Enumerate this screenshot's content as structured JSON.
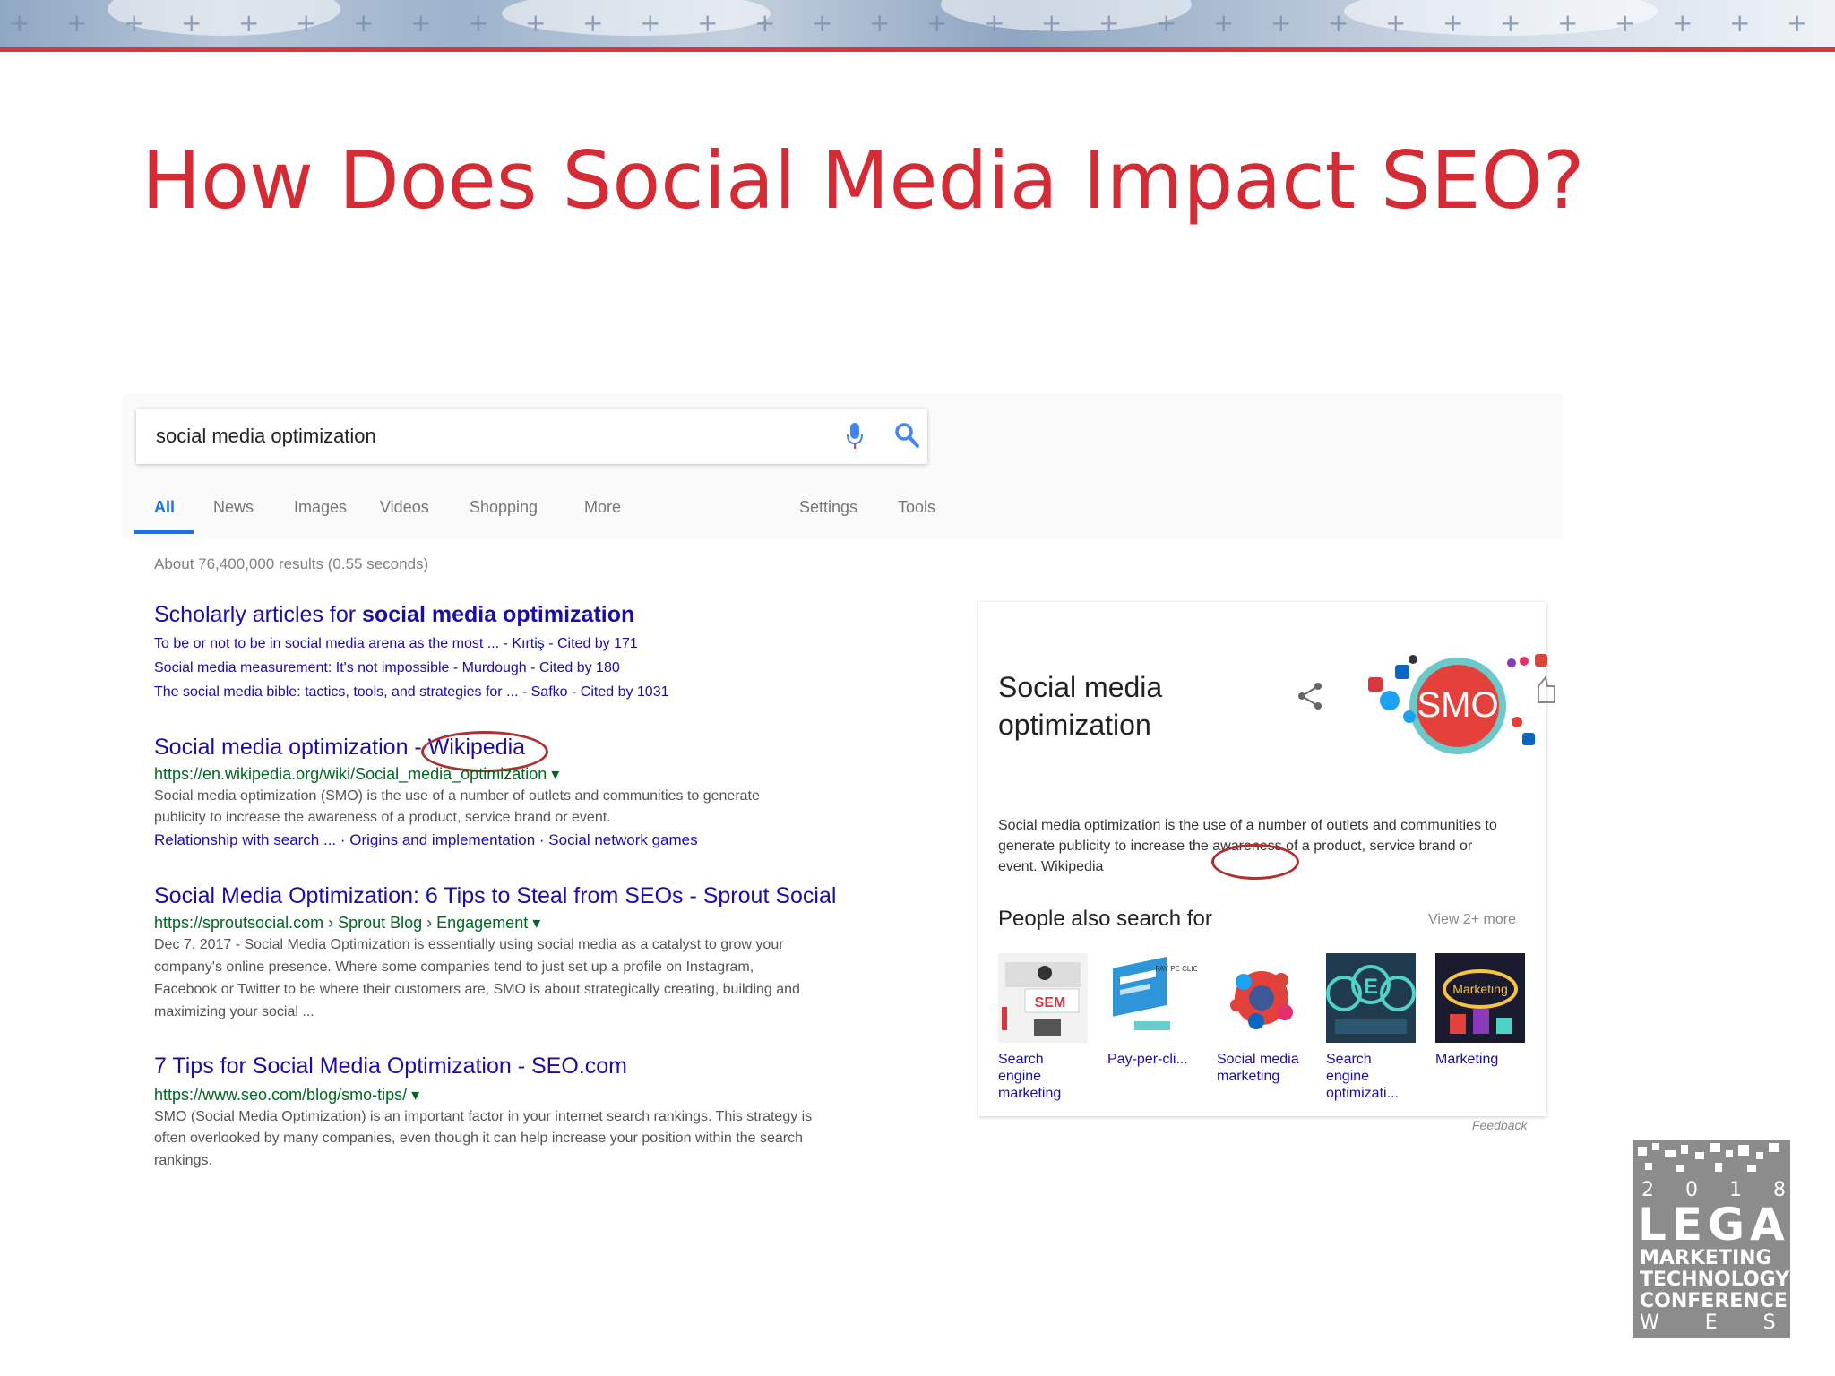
{
  "slide": {
    "title": "How Does Social Media Impact SEO?"
  },
  "search": {
    "query": "social media optimization",
    "tabs": [
      "All",
      "News",
      "Images",
      "Videos",
      "Shopping",
      "More"
    ],
    "settings_label": "Settings",
    "tools_label": "Tools",
    "stats": "About 76,400,000 results (0.55 seconds)"
  },
  "results": {
    "scholar": {
      "title_prefix": "Scholarly articles for ",
      "title_bold": "social media optimization",
      "lines": [
        "To be or not to be in social media arena as the most ... - Kırtiş - Cited by 171",
        "Social media measurement: It's not impossible - Murdough - Cited by 180",
        "The social media bible: tactics, tools, and strategies for ... - Safko - Cited by 1031"
      ]
    },
    "wiki": {
      "title": "Social media optimization - Wikipedia",
      "url": "https://en.wikipedia.org/wiki/Social_media_optimization ▾",
      "snippet": [
        "Social media optimization (SMO) is the use of a number of outlets and communities to generate",
        "publicity to increase the awareness of a product, service brand or event."
      ],
      "sitelinks": "Relationship with search ... · Origins and implementation · Social network games"
    },
    "sprout": {
      "title": "Social Media Optimization: 6 Tips to Steal from SEOs - Sprout Social",
      "url": "https://sproutsocial.com › Sprout Blog › Engagement ▾",
      "snippet": [
        "Dec 7, 2017 - Social Media Optimization is essentially using social media as a catalyst to grow your",
        "company's online presence. Where some companies tend to just set up a profile on Instagram,",
        "Facebook or Twitter to be where their customers are, SMO is about strategically creating, building and",
        "maximizing your social ..."
      ]
    },
    "seocom": {
      "title": "7 Tips for Social Media Optimization - SEO.com",
      "url": "https://www.seo.com/blog/smo-tips/ ▾",
      "snippet": [
        "SMO (Social Media Optimization) is an important factor in your internet search rankings. This strategy is",
        "often overlooked by many companies, even though it can help increase your position within the search",
        "rankings."
      ]
    }
  },
  "knowledge_panel": {
    "title": "Social media optimization",
    "image_text": "SMO",
    "description": "Social media optimization is the use of a number of outlets and communities to generate publicity to increase the awareness of a product, service brand or event. Wikipedia",
    "people_also_search": "People also search for",
    "view_more": "View 2+ more",
    "items": [
      {
        "label": "Search engine marketing",
        "thumb_text": "SEM"
      },
      {
        "label": "Pay-per-cli...",
        "thumb_text": "PAY PE CLICK"
      },
      {
        "label": "Social media marketing",
        "thumb_text": ""
      },
      {
        "label": "Search engine optimizati...",
        "thumb_text": "E"
      },
      {
        "label": "Marketing",
        "thumb_text": "Marketing"
      }
    ],
    "feedback": "Feedback"
  },
  "logo": {
    "year": "2 0 1 8",
    "line1": "LEGAL",
    "line2": "MARKETING",
    "line3": "TECHNOLOGY",
    "line4": "CONFERENCE",
    "line5": "W E S T"
  },
  "colors": {
    "title_red": "#d52b35",
    "link_blue": "#1a0dab",
    "url_green": "#006621",
    "accent_blue": "#1a73e8"
  }
}
